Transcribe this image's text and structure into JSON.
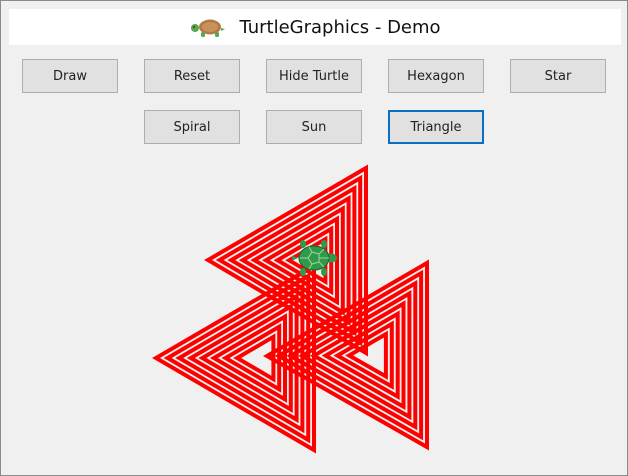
{
  "window": {
    "title": "TurtleGraphics - Demo",
    "logo_icon": "turtle-icon"
  },
  "toolbar": {
    "row1": [
      "Draw",
      "Reset",
      "Hide Turtle",
      "Hexagon",
      "Star"
    ],
    "row2": [
      "Spiral",
      "Sun",
      "Triangle"
    ],
    "focused": "Triangle"
  },
  "canvas": {
    "stroke_color": "#ff0000",
    "turtle_color": "#2e9a4a",
    "turtle_icon": "turtle-icon"
  }
}
